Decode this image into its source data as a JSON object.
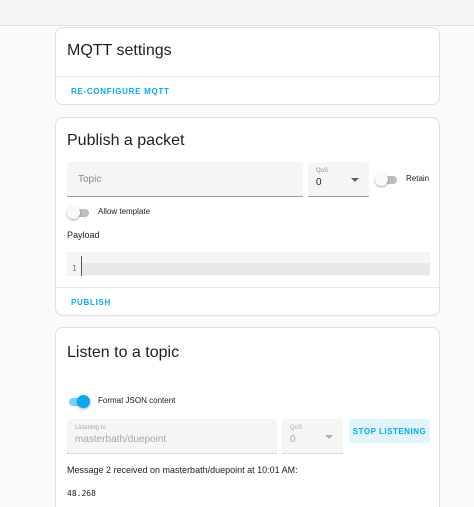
{
  "mqtt_settings": {
    "title": "MQTT settings",
    "reconfigure_label": "RE-CONFIGURE MQTT"
  },
  "publish": {
    "title": "Publish a packet",
    "topic_placeholder": "Topic",
    "qos_label": "QoS",
    "qos_value": "0",
    "retain_label": "Retain",
    "retain_on": false,
    "allow_template_label": "Allow template",
    "allow_template_on": false,
    "payload_label": "Payload",
    "payload_line_number": "1",
    "publish_label": "PUBLISH"
  },
  "listen": {
    "title": "Listen to a topic",
    "format_json_label": "Format JSON content",
    "format_json_on": true,
    "listening_label": "Listening to",
    "listening_value": "masterbath/duepoint",
    "qos_label": "QoS",
    "qos_value": "0",
    "stop_label": "STOP LISTENING",
    "message_text": "Message 2 received on masterbath/duepoint at 10:01 AM:",
    "message_value": "48.268"
  },
  "colors": {
    "accent": "#03a9f4",
    "card_border": "#e0e0e0"
  }
}
